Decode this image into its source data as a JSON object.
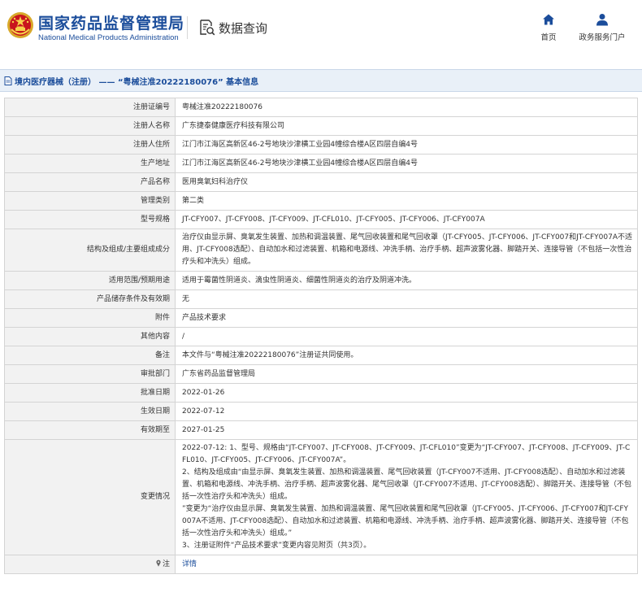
{
  "header": {
    "brand_cn": "国家药品监督管理局",
    "brand_en": "National Medical Products Administration",
    "query_label": "数据查询",
    "nav": {
      "home_label": "首页",
      "portal_label": "政务服务门户"
    }
  },
  "title_bar": {
    "text": "境内医疗器械（注册） —— “粤械注准20222180076” 基本信息"
  },
  "fields": [
    {
      "key": "reg_no",
      "label": "注册证编号",
      "value": "粤械注准20222180076"
    },
    {
      "key": "registrant",
      "label": "注册人名称",
      "value": "广东捷泰健康医疗科技有限公司"
    },
    {
      "key": "registrant_address",
      "label": "注册人住所",
      "value": "江门市江海区高新区46-2号地块沙津横工业园4幢综合楼A区四层自编4号"
    },
    {
      "key": "production_address",
      "label": "生产地址",
      "value": "江门市江海区高新区46-2号地块沙津横工业园4幢综合楼A区四层自编4号"
    },
    {
      "key": "product_name",
      "label": "产品名称",
      "value": "医用臭氧妇科治疗仪"
    },
    {
      "key": "category",
      "label": "管理类别",
      "value": "第二类"
    },
    {
      "key": "model",
      "label": "型号规格",
      "value": "JT-CFY007、JT-CFY008、JT-CFY009、JT-CFL010、JT-CFY005、JT-CFY006、JT-CFY007A"
    },
    {
      "key": "structure",
      "label": "结构及组成/主要组成成分",
      "value": "治疗仪由显示屏、臭氧发生装置、加热和调温装置、尾气回收装置和尾气回收罩（JT-CFY005、JT-CFY006、JT-CFY007和JT-CFY007A不适用、JT-CFY008选配）、自动加水和过滤装置、机箱和电源线、冲洗手柄、治疗手柄、超声波雾化器、脚踏开关、连接导管（不包括一次性治疗头和冲洗头）组成。"
    },
    {
      "key": "scope",
      "label": "适用范围/预期用途",
      "value": "适用于霉菌性阴道炎、滴虫性阴道炎、细菌性阴道炎的治疗及阴道冲洗。"
    },
    {
      "key": "storage",
      "label": "产品储存条件及有效期",
      "value": "无"
    },
    {
      "key": "attachment",
      "label": "附件",
      "value": "产品技术要求"
    },
    {
      "key": "other",
      "label": "其他内容",
      "value": "/"
    },
    {
      "key": "remark",
      "label": "备注",
      "value": "本文件与“粤械注准20222180076”注册证共同使用。"
    },
    {
      "key": "approval_dept",
      "label": "审批部门",
      "value": "广东省药品监督管理局"
    },
    {
      "key": "approval_date",
      "label": "批准日期",
      "value": "2022-01-26"
    },
    {
      "key": "effective_date",
      "label": "生效日期",
      "value": "2022-07-12"
    },
    {
      "key": "valid_until",
      "label": "有效期至",
      "value": "2027-01-25"
    }
  ],
  "change": {
    "label": "变更情况",
    "lines": [
      "2022-07-12: 1、型号、规格由“JT-CFY007、JT-CFY008、JT-CFY009、JT-CFL010”变更为“JT-CFY007、JT-CFY008、JT-CFY009、JT-CFL010、JT-CFY005、JT-CFY006、JT-CFY007A”。",
      "2、结构及组成由“由显示屏、臭氧发生装置、加热和调温装置、尾气回收装置（JT-CFY007不适用、JT-CFY008选配）、自动加水和过滤装置、机箱和电源线、冲洗手柄、治疗手柄、超声波雾化器、尾气回收罩（JT-CFY007不适用、JT-CFY008选配）、脚踏开关、连接导管（不包括一次性治疗头和冲洗头）组成。",
      "”变更为“治疗仪由显示屏、臭氧发生装置、加热和调温装置、尾气回收装置和尾气回收罩（JT-CFY005、JT-CFY006、JT-CFY007和JT-CFY007A不适用、JT-CFY008选配）、自动加水和过滤装置、机箱和电源线、冲洗手柄、治疗手柄、超声波雾化器、脚踏开关、连接导管（不包括一次性治疗头和冲洗头）组成。”",
      "3、注册证附件“产品技术要求”变更内容见附页（共3页）。"
    ]
  },
  "note": {
    "label": "注",
    "link_text": "详情"
  },
  "colors": {
    "brand_blue": "#1b4d9b",
    "label_bg": "#f2f2f2",
    "title_bar_bg": "#e9f0f8"
  }
}
